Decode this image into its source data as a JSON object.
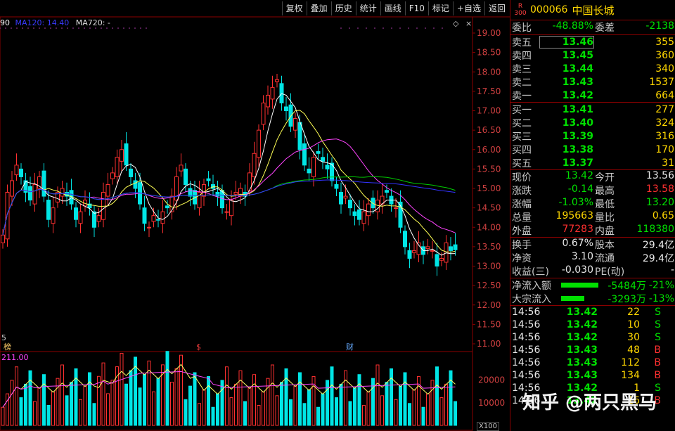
{
  "toolbar": [
    "复权",
    "叠加",
    "历史",
    "统计",
    "画线",
    "F10",
    "标记",
    "+自选",
    "返回"
  ],
  "ma_legend": {
    "left": "90",
    "ma120": "MA120: 14.40",
    "ma720": "MA720: -"
  },
  "price_axis": [
    "19.00",
    "18.50",
    "18.00",
    "17.50",
    "17.00",
    "16.50",
    "16.00",
    "15.50",
    "15.00",
    "14.50",
    "14.00",
    "13.50",
    "13.00",
    "12.50",
    "12.00",
    "11.50",
    "11.00"
  ],
  "vol_axis": [
    "20000",
    "10000"
  ],
  "vol_ma": "211.00",
  "x100": "X100",
  "left_edge": "5",
  "event_labels": [
    {
      "text": "榜"
    },
    {
      "text": "$"
    },
    {
      "text": "财"
    }
  ],
  "colors": {
    "up": "#ff3030",
    "down": "#00e5e5",
    "ma5": "#ffffff",
    "ma10": "#ffff55",
    "ma20": "#ff44ff",
    "ma60": "#00cc00",
    "ma120": "#3333ff",
    "ma250": "#cccccc"
  },
  "quote": {
    "badge_top": "R",
    "badge_bottom": "300",
    "code": "000066",
    "name": "中国长城",
    "weibi_label": "委比",
    "weibi": "-48.88%",
    "weicha_label": "委差",
    "weicha": "-2138",
    "sells": [
      {
        "label": "卖五",
        "price": "13.46",
        "vol": "355"
      },
      {
        "label": "卖四",
        "price": "13.45",
        "vol": "360"
      },
      {
        "label": "卖三",
        "price": "13.44",
        "vol": "340"
      },
      {
        "label": "卖二",
        "price": "13.43",
        "vol": "1537"
      },
      {
        "label": "卖一",
        "price": "13.42",
        "vol": "664"
      }
    ],
    "buys": [
      {
        "label": "买一",
        "price": "13.41",
        "vol": "277"
      },
      {
        "label": "买二",
        "price": "13.40",
        "vol": "324"
      },
      {
        "label": "买三",
        "price": "13.39",
        "vol": "316"
      },
      {
        "label": "买四",
        "price": "13.38",
        "vol": "170"
      },
      {
        "label": "买五",
        "price": "13.37",
        "vol": "31"
      }
    ],
    "stats": [
      {
        "k1": "现价",
        "v1": "13.42",
        "c1": "g",
        "k2": "今开",
        "v2": "13.56",
        "c2": "w"
      },
      {
        "k1": "涨跌",
        "v1": "-0.14",
        "c1": "g",
        "k2": "最高",
        "v2": "13.58",
        "c2": "r"
      },
      {
        "k1": "涨幅",
        "v1": "-1.03%",
        "c1": "g",
        "k2": "最低",
        "v2": "13.20",
        "c2": "g"
      },
      {
        "k1": "总量",
        "v1": "195663",
        "c1": "y",
        "k2": "量比",
        "v2": "0.65",
        "c2": "y"
      },
      {
        "k1": "外盘",
        "v1": "77283",
        "c1": "r",
        "k2": "内盘",
        "v2": "118380",
        "c2": "g"
      }
    ],
    "stats2": [
      {
        "k1": "换手",
        "v1": "0.67%",
        "k2": "股本",
        "v2": "29.4亿"
      },
      {
        "k1": "净资",
        "v1": "3.10",
        "k2": "流通",
        "v2": "29.4亿"
      },
      {
        "k1": "收益(三)",
        "v1": "-0.030",
        "k2": "PE(动)",
        "v2": "-"
      }
    ],
    "flows": [
      {
        "label": "净流入额",
        "value": "-5484万",
        "pct": "-21%",
        "fill": 0.21
      },
      {
        "label": "大宗流入",
        "value": "-3293万",
        "pct": "-13%",
        "fill": 0.13
      }
    ],
    "ticks": [
      {
        "time": "14:56",
        "price": "13.42",
        "qty": "22",
        "flag": "S"
      },
      {
        "time": "14:56",
        "price": "13.42",
        "qty": "10",
        "flag": "S"
      },
      {
        "time": "14:56",
        "price": "13.42",
        "qty": "30",
        "flag": "S"
      },
      {
        "time": "14:56",
        "price": "13.43",
        "qty": "48",
        "flag": "B"
      },
      {
        "time": "14:56",
        "price": "13.43",
        "qty": "112",
        "flag": "B"
      },
      {
        "time": "14:56",
        "price": "13.43",
        "qty": "134",
        "flag": "B"
      },
      {
        "time": "14:56",
        "price": "13.42",
        "qty": "1",
        "flag": "S"
      },
      {
        "time": "14:56",
        "price": "13.42",
        "qty": "16",
        "flag": "B"
      }
    ]
  },
  "watermark": "知乎 @两只黑马"
}
